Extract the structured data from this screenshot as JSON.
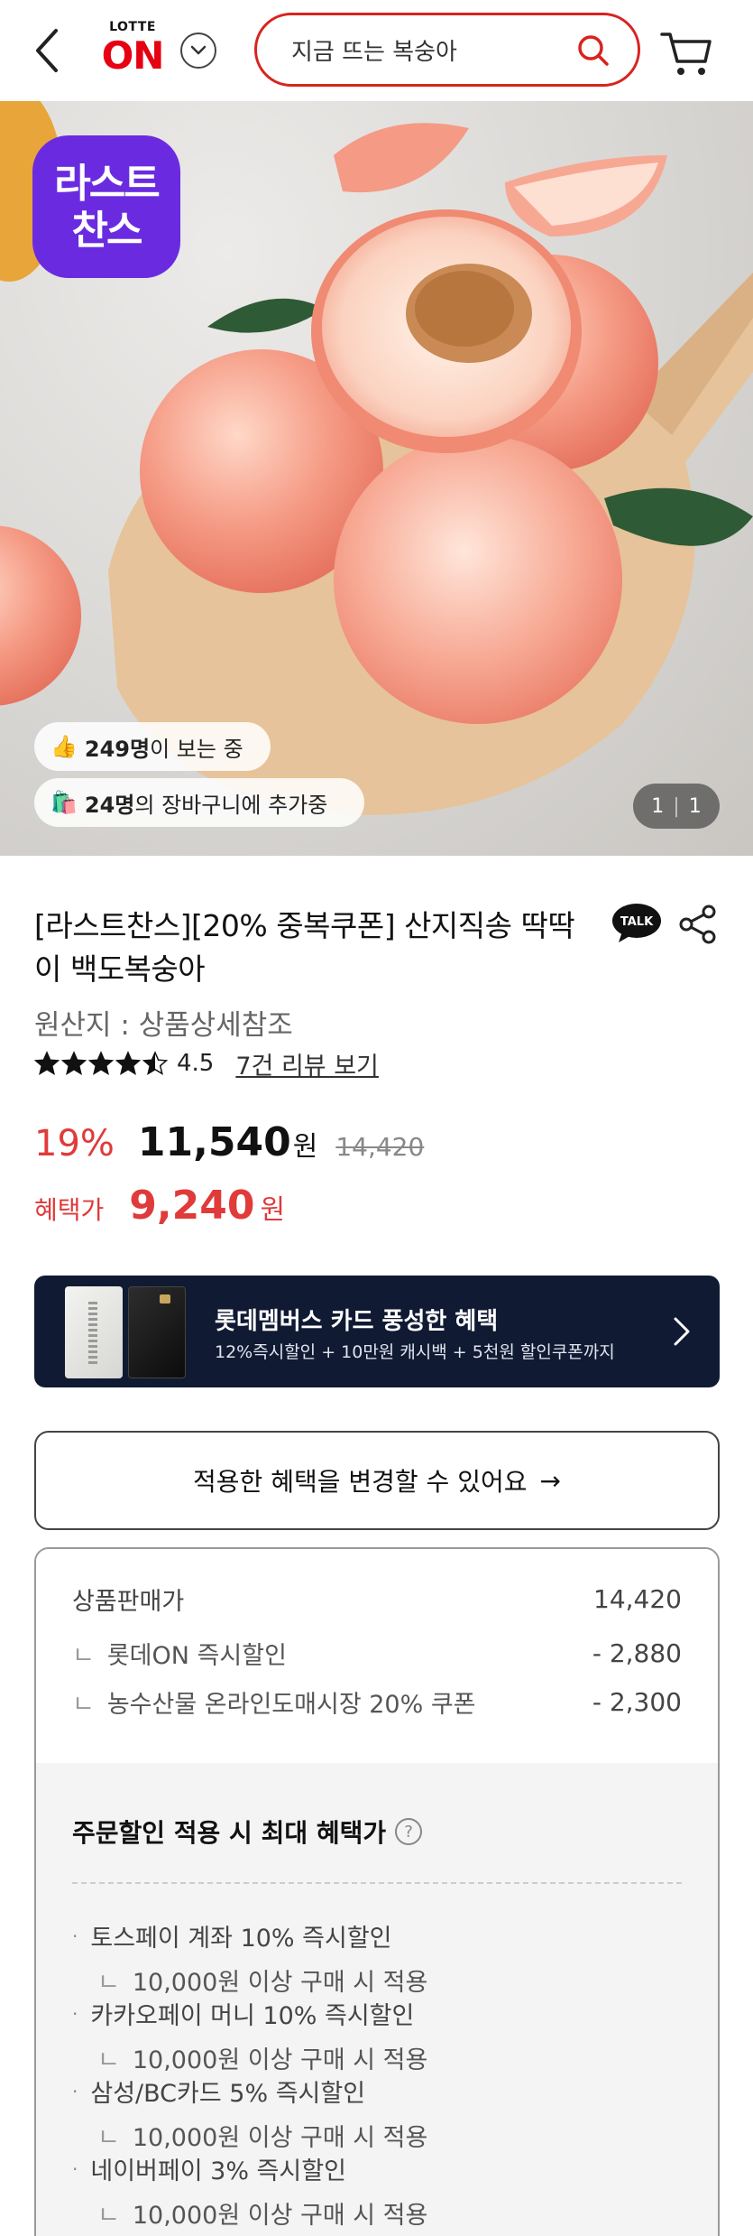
{
  "header": {
    "logo_top": "LOTTE",
    "logo_main": "ON",
    "search_placeholder": "지금 뜨는 복숭아"
  },
  "hero": {
    "badge_line1": "라스트",
    "badge_line2": "찬스",
    "viewers_icon": "👍",
    "viewers_count": "249명",
    "viewers_suffix": "이 보는 중",
    "cart_icon": "🛍️",
    "cart_count": "24명",
    "cart_suffix": "의 장바구니에 추가중",
    "page_current": "1",
    "page_total": "1"
  },
  "product": {
    "title": "[라스트찬스][20% 중복쿠폰] 산지직송 딱딱이 백도복숭아",
    "talk_label": "TALK",
    "origin": "원산지 : 상품상세참조",
    "rating": "4.5",
    "rating_value": 4.5,
    "review_link": "7건 리뷰 보기"
  },
  "price": {
    "discount": "19%",
    "sale": "11,540",
    "won": "원",
    "original": "14,420",
    "benefit_label": "혜택가",
    "benefit_price": "9,240",
    "benefit_won": "원"
  },
  "card_banner": {
    "title": "롯데멤버스 카드 풍성한 혜택",
    "subtitle": "12%즉시할인 + 10만원 캐시백 + 5천원 할인쿠폰까지"
  },
  "change_benefit": {
    "label": "적용한 혜택을 변경할 수 있어요",
    "arrow": "→"
  },
  "detail": {
    "rows": [
      {
        "label": "상품판매가",
        "value": "14,420"
      },
      {
        "label": "롯데ON 즉시할인",
        "value": "- 2,880"
      },
      {
        "label": "농수산물 온라인도매시장 20% 쿠폰",
        "value": "- 2,300"
      }
    ],
    "hook": "ㄴ",
    "max_title": "주문할인 적용 시 최대 혜택가",
    "help": "?",
    "promos": [
      {
        "main": "토스페이 계좌 10% 즉시할인",
        "cond": "10,000원 이상 구매 시 적용"
      },
      {
        "main": "카카오페이 머니 10% 즉시할인",
        "cond": "10,000원 이상 구매 시 적용"
      },
      {
        "main": "삼성/BC카드 5% 즉시할인",
        "cond": "10,000원 이상 구매 시 적용"
      },
      {
        "main": "네이버페이 3% 즉시할인",
        "cond": "10,000원 이상 구매 시 적용"
      }
    ],
    "bullet": "·"
  },
  "colors": {
    "brand_red": "#e60012",
    "search_border": "#d9231e",
    "discount_red": "#e03a3a",
    "badge_purple": "#6a2be0",
    "card_navy": "#101a33"
  }
}
